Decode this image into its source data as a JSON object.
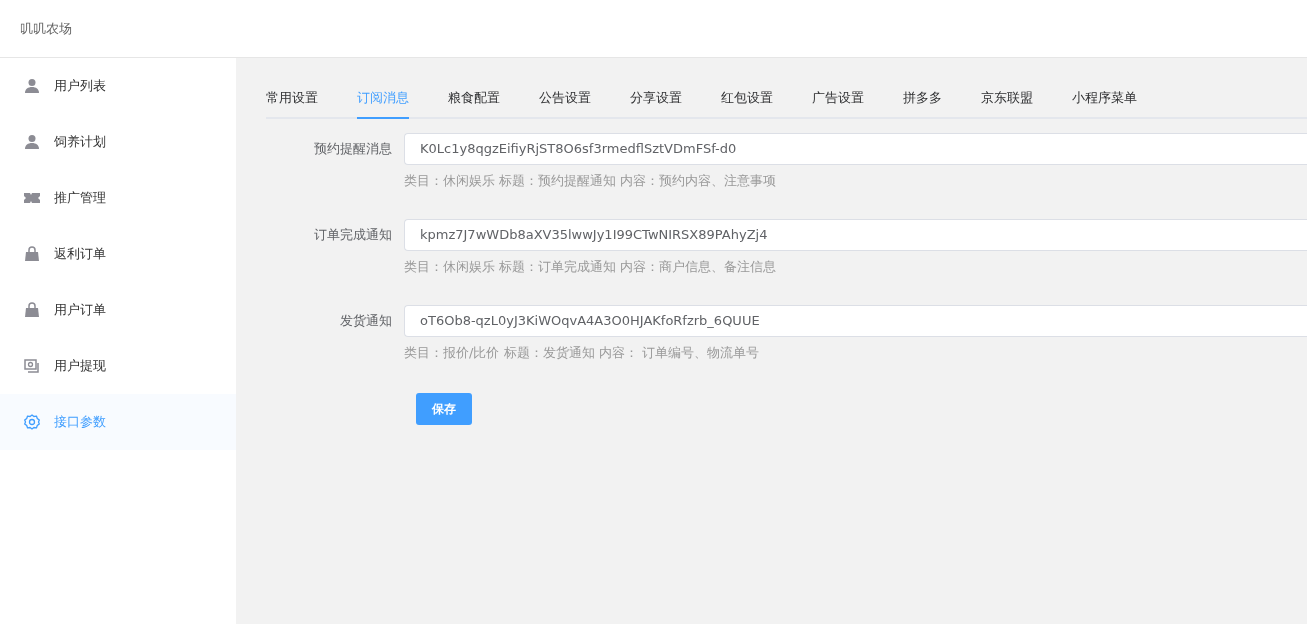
{
  "header": {
    "title": "叽叽农场"
  },
  "sidebar": {
    "items": [
      {
        "label": "用户列表",
        "selected": false
      },
      {
        "label": "饲养计划",
        "selected": false
      },
      {
        "label": "推广管理",
        "selected": false
      },
      {
        "label": "返利订单",
        "selected": false
      },
      {
        "label": "用户订单",
        "selected": false
      },
      {
        "label": "用户提现",
        "selected": false
      },
      {
        "label": "接口参数",
        "selected": true
      }
    ]
  },
  "tabs": [
    {
      "label": "常用设置",
      "selected": false
    },
    {
      "label": "订阅消息",
      "selected": true
    },
    {
      "label": "粮食配置",
      "selected": false
    },
    {
      "label": "公告设置",
      "selected": false
    },
    {
      "label": "分享设置",
      "selected": false
    },
    {
      "label": "红包设置",
      "selected": false
    },
    {
      "label": "广告设置",
      "selected": false
    },
    {
      "label": "拼多多",
      "selected": false
    },
    {
      "label": "京东联盟",
      "selected": false
    },
    {
      "label": "小程序菜单",
      "selected": false
    }
  ],
  "form": {
    "fields": [
      {
        "label": "预约提醒消息",
        "value": "K0Lc1y8qgzEifiyRjST8O6sf3rmedflSztVDmFSf-d0",
        "hint": "类目：休闲娱乐 标题：预约提醒通知 内容：预约内容、注意事项"
      },
      {
        "label": "订单完成通知",
        "value": "kpmz7J7wWDb8aXV35lwwJy1I99CTwNIRSX89PAhyZj4",
        "hint": "类目：休闲娱乐 标题：订单完成通知 内容：商户信息、备注信息"
      },
      {
        "label": "发货通知",
        "value": "oT6Ob8-qzL0yJ3KiWOqvA4A3O0HJAKfoRfzrb_6QUUE",
        "hint": "类目：报价/比价 标题：发货通知 内容： 订单编号、物流单号"
      }
    ],
    "save_button": "保存"
  }
}
